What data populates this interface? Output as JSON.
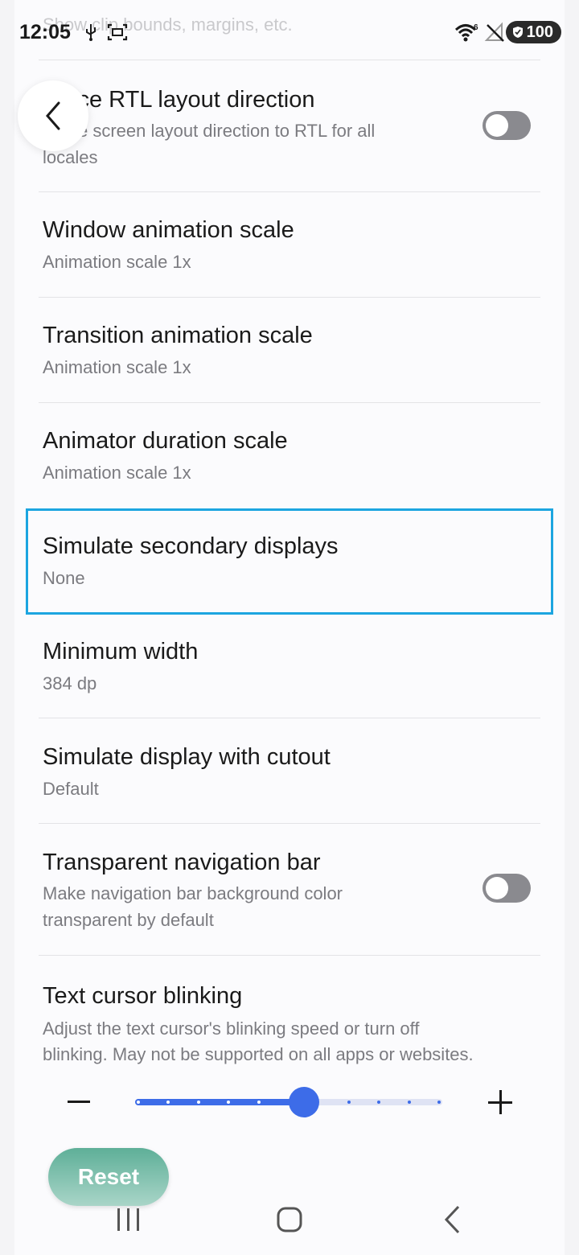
{
  "status_bar": {
    "time": "12:05",
    "battery": "100",
    "icons": [
      "usb-icon",
      "screenshot-icon",
      "wifi-icon",
      "no-signal-icon",
      "battery-shield-icon"
    ]
  },
  "faded_top_text": "Show clip bounds, margins, etc.",
  "items": [
    {
      "title": "Force RTL layout direction",
      "subtitle_lines": [
        "Force screen layout direction to RTL for all",
        "locales"
      ],
      "toggle": false
    },
    {
      "title": "Window animation scale",
      "subtitle": "Animation scale 1x"
    },
    {
      "title": "Transition animation scale",
      "subtitle": "Animation scale 1x"
    },
    {
      "title": "Animator duration scale",
      "subtitle": "Animation scale 1x"
    },
    {
      "title": "Simulate secondary displays",
      "subtitle": "None"
    },
    {
      "title": "Minimum width",
      "subtitle": "384 dp"
    },
    {
      "title": "Simulate display with cutout",
      "subtitle": "Default"
    },
    {
      "title": "Transparent navigation bar",
      "subtitle_lines": [
        "Make navigation bar background color",
        "transparent by default"
      ],
      "toggle": false
    },
    {
      "title": "Text cursor blinking",
      "subtitle_lines": [
        "Adjust the text cursor's blinking speed or turn off",
        "blinking. May not be supported on all apps or websites."
      ]
    }
  ],
  "slider": {
    "fraction": 0.55,
    "steps": 11
  },
  "reset_label": "Reset",
  "colors": {
    "accent": "#3d6ce8",
    "highlight": "#1ca5e0",
    "reset": "#5eaf98"
  }
}
